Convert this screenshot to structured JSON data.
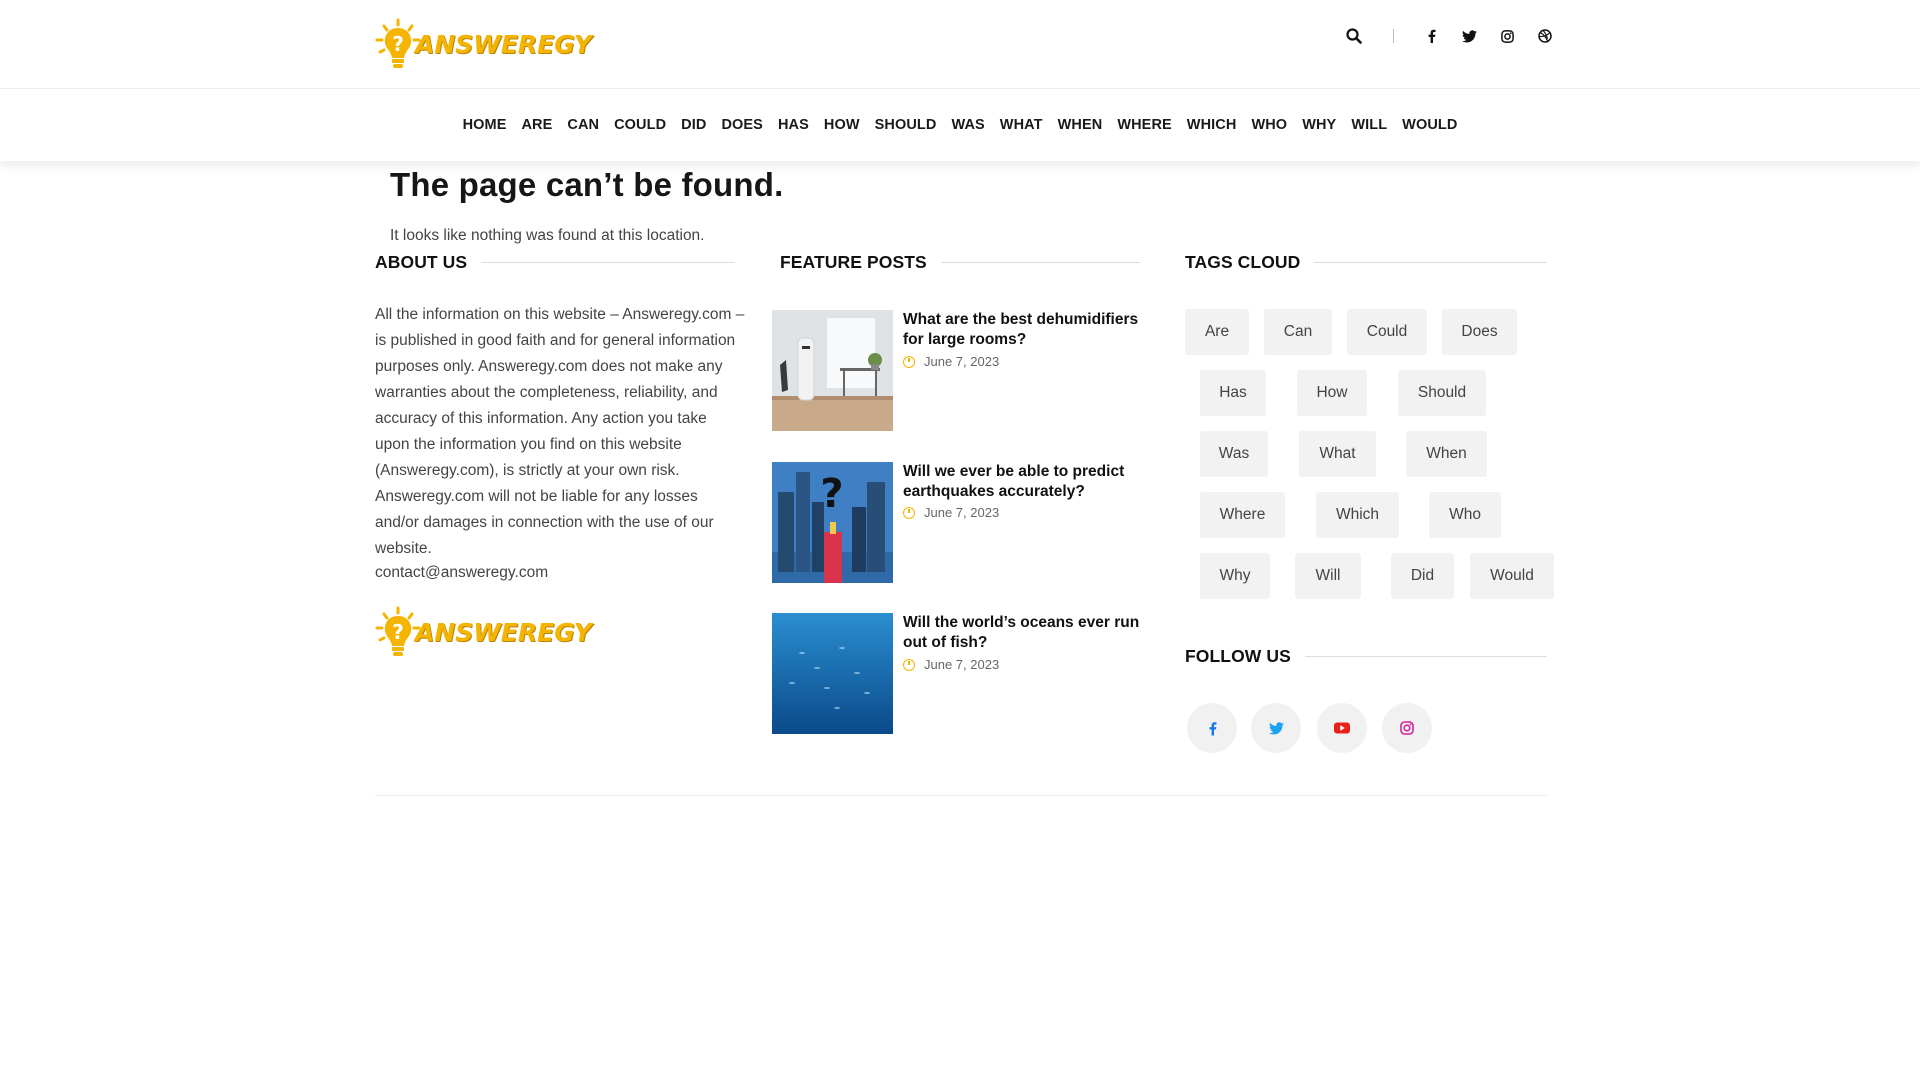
{
  "header": {
    "logo_text": "ANSWEREGY"
  },
  "nav": {
    "items": [
      "HOME",
      "ARE",
      "CAN",
      "COULD",
      "DID",
      "DOES",
      "HAS",
      "HOW",
      "SHOULD",
      "WAS",
      "WHAT",
      "WHEN",
      "WHERE",
      "WHICH",
      "WHO",
      "WHY",
      "WILL",
      "WOULD"
    ]
  },
  "error": {
    "title": "The page can’t be found.",
    "subtitle": "It looks like nothing was found at this location."
  },
  "about": {
    "heading": "ABOUT US",
    "text": "All the information on this website – Answeregy.com – is published in good faith and for general information purposes only. Answeregy.com does not make any warranties about the completeness, reliability, and accuracy of this information. Any action you take upon the information you find on this website (Answeregy.com), is strictly at your own risk. Answeregy.com will not be liable for any losses and/or damages in connection with the use of our website.",
    "email": "contact@answeregy.com",
    "logo_text": "ANSWEREGY"
  },
  "feature": {
    "heading": "FEATURE POSTS",
    "posts": [
      {
        "title": "What are the best dehumidifiers for large rooms?",
        "date": "June 7, 2023"
      },
      {
        "title": "Will we ever be able to predict earthquakes accurately?",
        "date": "June 7, 2023"
      },
      {
        "title": "Will the world’s oceans ever run out of fish?",
        "date": "June 7, 2023"
      }
    ]
  },
  "tags": {
    "heading": "TAGS CLOUD",
    "items": [
      "Are",
      "Can",
      "Could",
      "Does",
      "Has",
      "How",
      "Should",
      "Was",
      "What",
      "When",
      "Where",
      "Which",
      "Who",
      "Why",
      "Will",
      "Did",
      "Would"
    ]
  },
  "follow": {
    "heading": "FOLLOW US",
    "networks": [
      "facebook-icon",
      "twitter-icon",
      "youtube-icon",
      "instagram-icon"
    ]
  },
  "colors": {
    "brand": "#f4b400",
    "facebook": "#1877f2",
    "twitter": "#1da1f2",
    "youtube": "#e62117",
    "instagram": "#d6249f"
  }
}
